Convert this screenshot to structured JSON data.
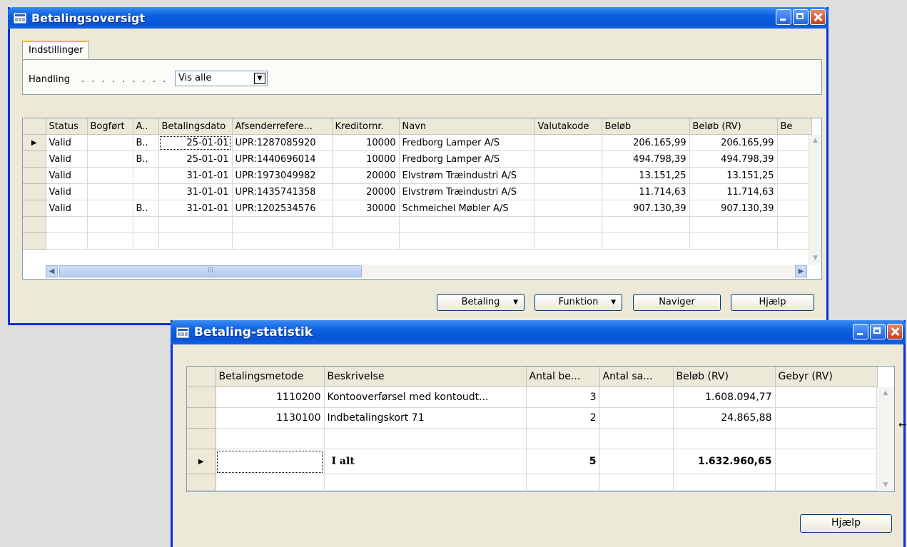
{
  "win1": {
    "title": "Betalingsoversigt",
    "tab": "Indstillinger",
    "handling_label": "Handling",
    "handling_dots": ". . . . . . . . .",
    "handling_value": "Vis alle",
    "columns": [
      "Status",
      "Bogført",
      "A..",
      "Betalingsdato",
      "Afsenderrefere...",
      "Kreditornr.",
      "Navn",
      "Valutakode",
      "Beløb",
      "Beløb (RV)",
      "Be"
    ],
    "rows": [
      [
        "Valid",
        "",
        "B..",
        "25-01-01",
        "UPR:1287085920",
        "10000",
        "Fredborg Lamper A/S",
        "",
        "206.165,99",
        "206.165,99",
        ""
      ],
      [
        "Valid",
        "",
        "B..",
        "25-01-01",
        "UPR:1440696014",
        "10000",
        "Fredborg Lamper A/S",
        "",
        "494.798,39",
        "494.798,39",
        ""
      ],
      [
        "Valid",
        "",
        "",
        "31-01-01",
        "UPR:1973049982",
        "20000",
        "Elvstrøm Træindustri A/S",
        "",
        "13.151,25",
        "13.151,25",
        ""
      ],
      [
        "Valid",
        "",
        "",
        "31-01-01",
        "UPR:1435741358",
        "20000",
        "Elvstrøm Træindustri A/S",
        "",
        "11.714,63",
        "11.714,63",
        ""
      ],
      [
        "Valid",
        "",
        "B..",
        "31-01-01",
        "UPR:1202534576",
        "30000",
        "Schmeichel Møbler A/S",
        "",
        "907.130,39",
        "907.130,39",
        ""
      ]
    ],
    "buttons": {
      "betaling": "Betaling",
      "funktion": "Funktion",
      "naviger": "Naviger",
      "hjaelp": "Hjælp"
    }
  },
  "win2": {
    "title": "Betaling-statistik",
    "columns": [
      "Betalingsmetode",
      "Beskrivelse",
      "Antal be...",
      "Antal sa...",
      "Beløb (RV)",
      "Gebyr (RV)"
    ],
    "rows": [
      [
        "1110200",
        "Kontooverførsel med kontoudt...",
        "3",
        "",
        "1.608.094,77",
        ""
      ],
      [
        "1130100",
        "Indbetalingskort 71",
        "2",
        "",
        "24.865,88",
        ""
      ]
    ],
    "total": [
      "",
      "I alt",
      "5",
      "",
      "1.632.960,65",
      ""
    ],
    "help_button": "Hjælp"
  }
}
